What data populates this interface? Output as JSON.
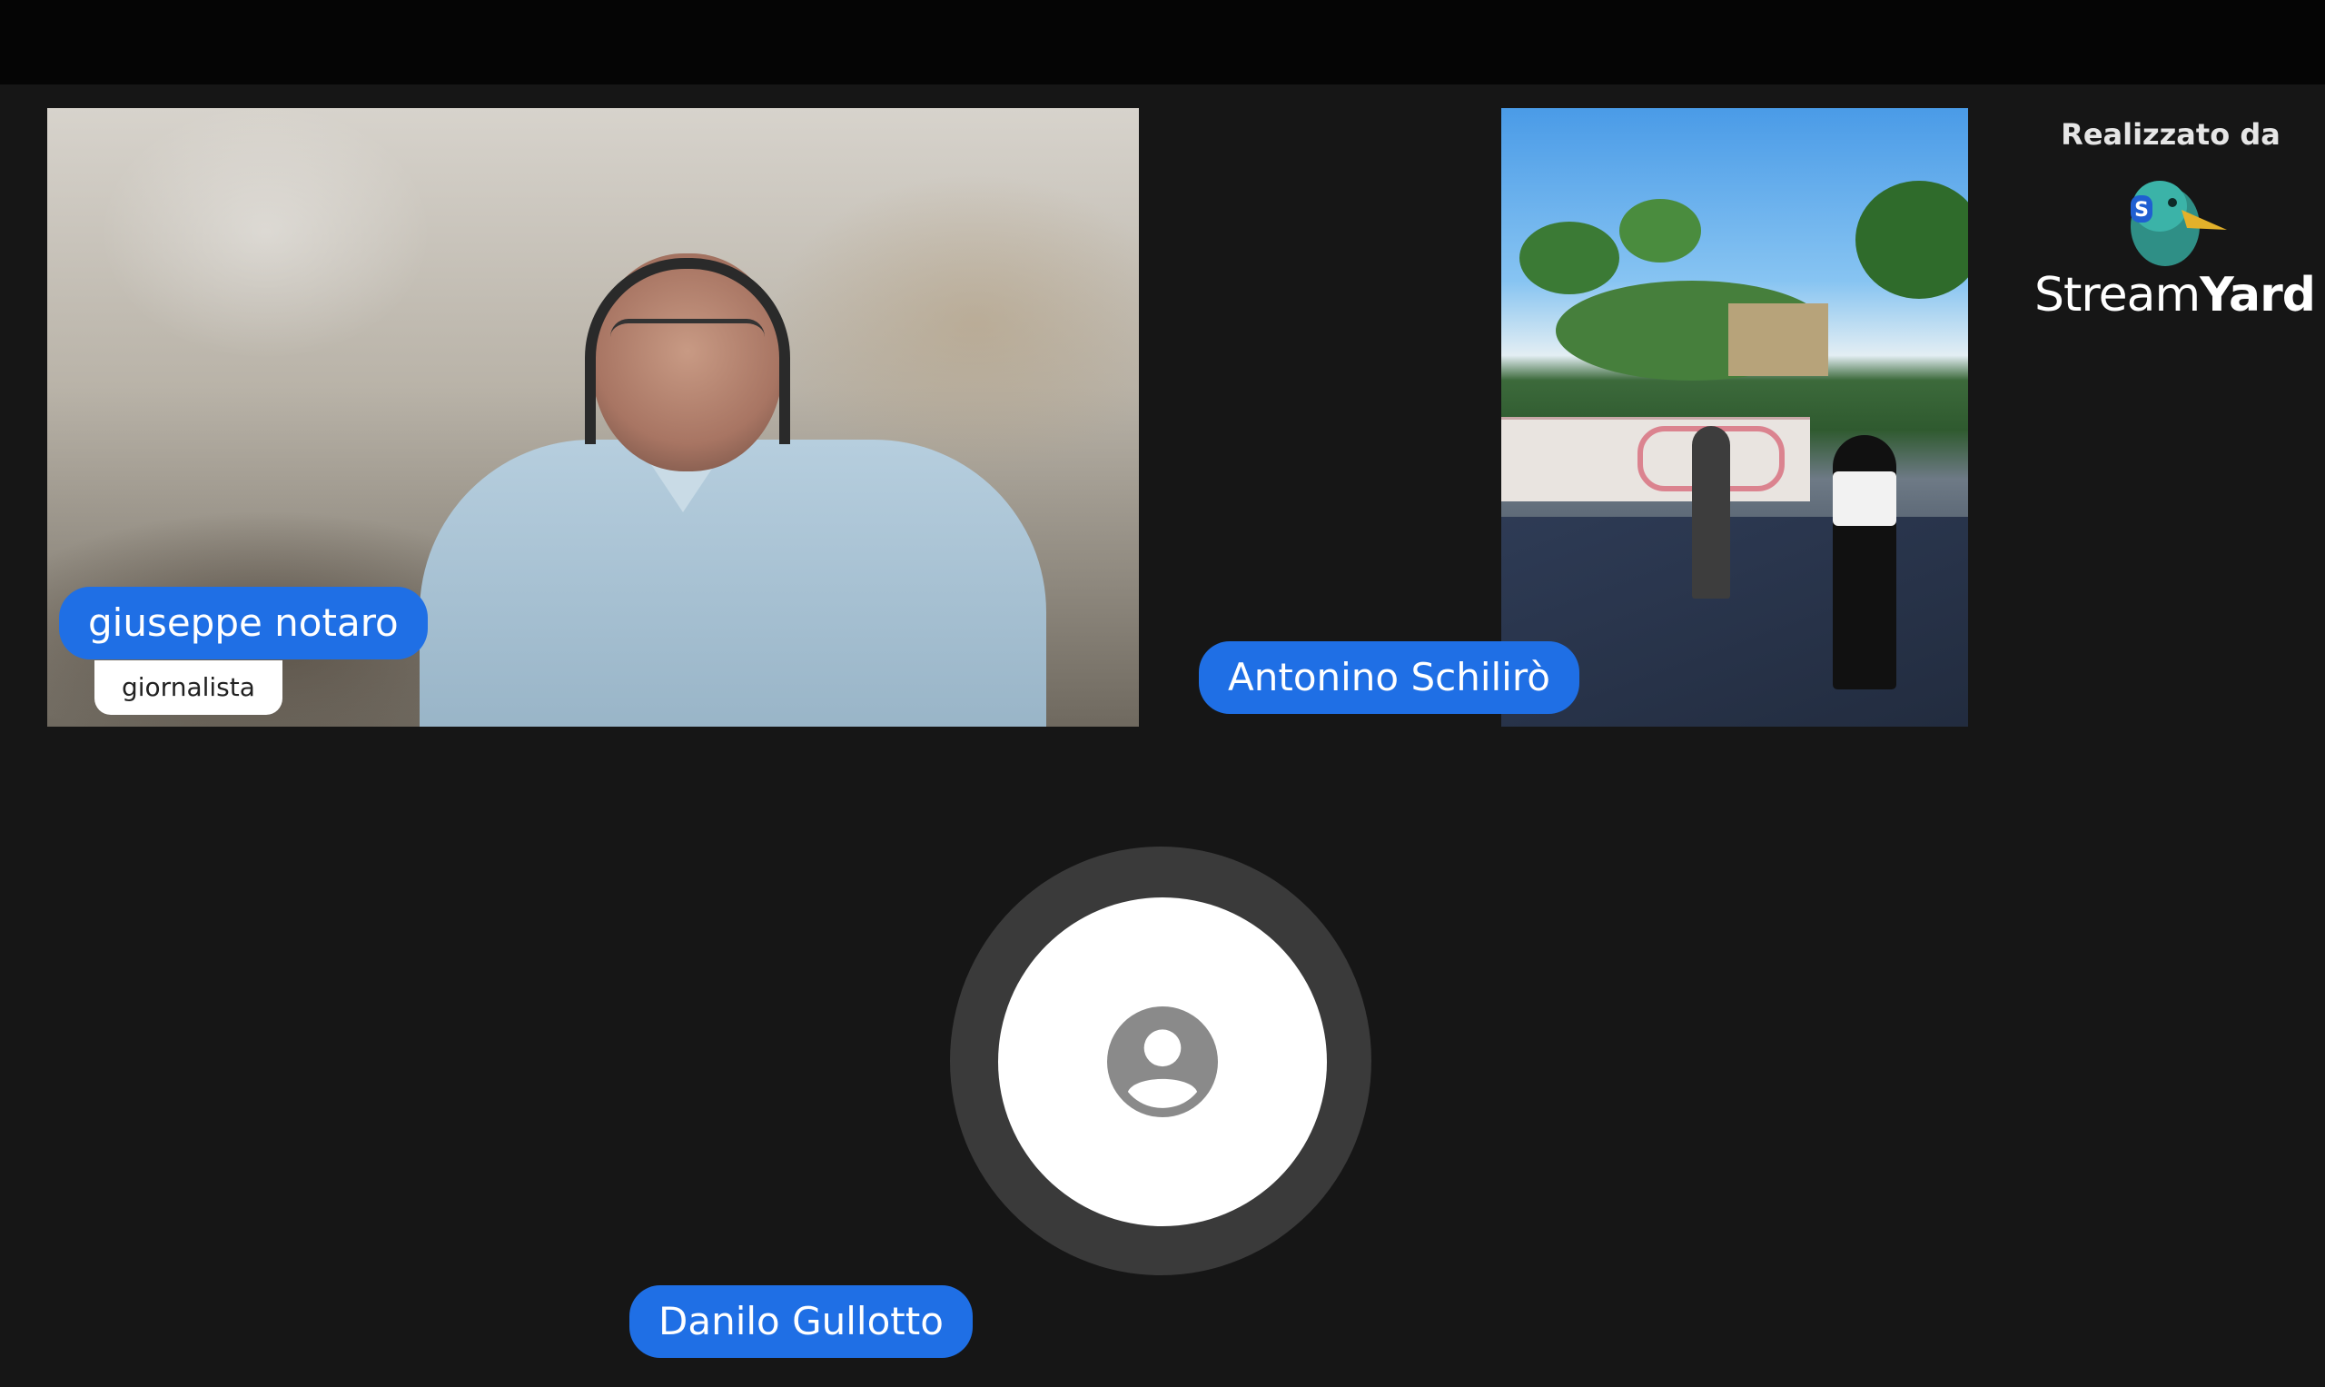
{
  "participants": [
    {
      "name": "giuseppe notaro",
      "role": "giornalista"
    },
    {
      "name": "Antonino Schilirò"
    },
    {
      "name": "Danilo Gullotto"
    }
  ],
  "branding": {
    "caption": "Realizzato da",
    "name_prefix": "Stream",
    "name_suffix": "Yard",
    "logo_icon": "streamyard-duck-icon"
  },
  "colors": {
    "name_pill": "#1f6fe5",
    "background": "#161616"
  },
  "avatar_icon": "user-placeholder-icon"
}
